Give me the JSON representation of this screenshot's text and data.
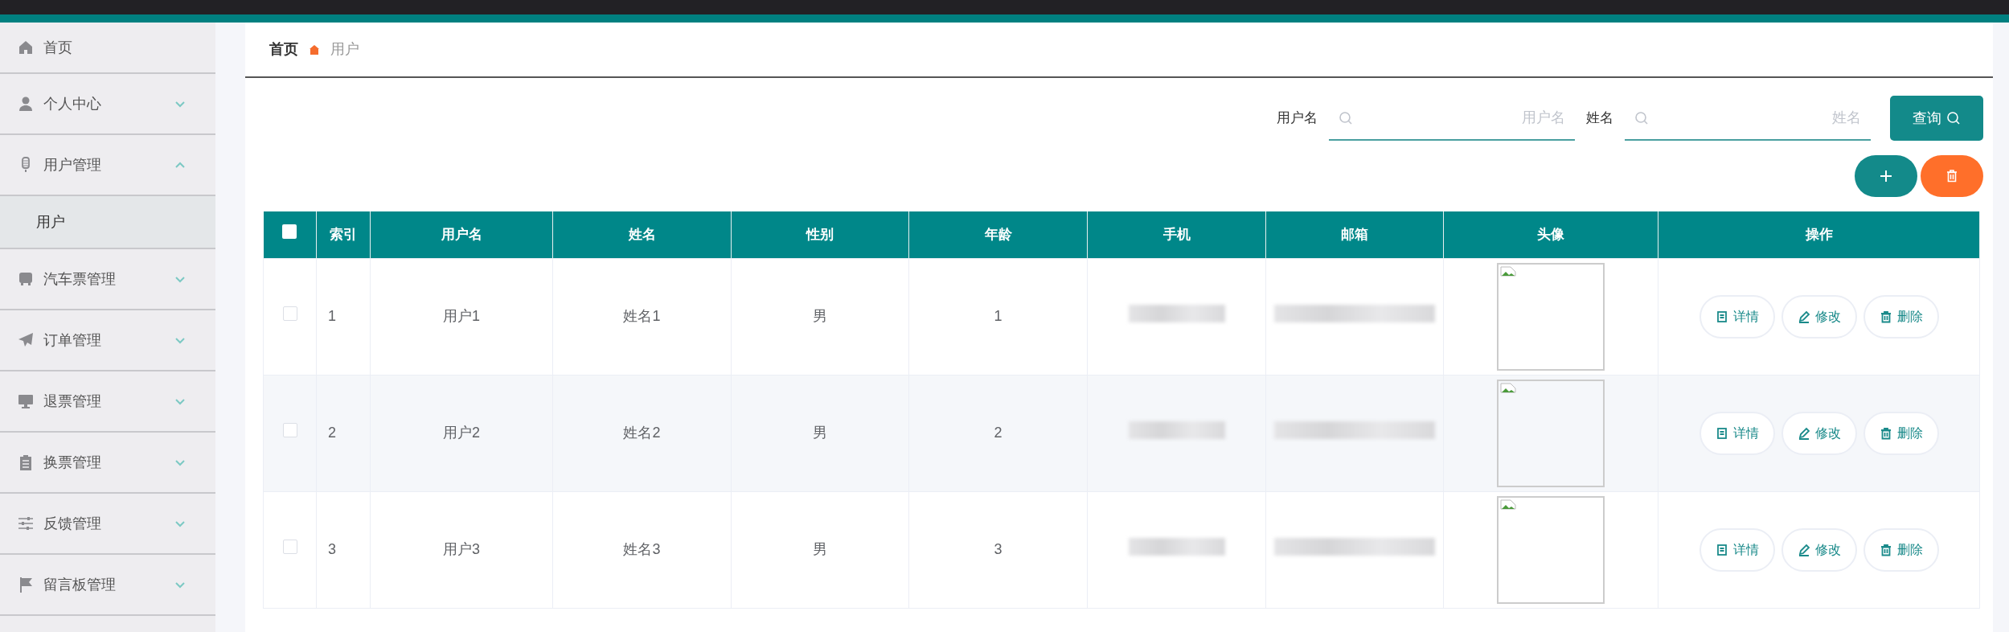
{
  "sidebar": {
    "items": [
      {
        "kind": "link",
        "label": "首页"
      },
      {
        "kind": "menu",
        "label": "个人中心",
        "expanded": false
      },
      {
        "kind": "menu",
        "label": "用户管理",
        "expanded": true,
        "children": [
          {
            "label": "用户",
            "selected": true
          }
        ]
      },
      {
        "kind": "menu",
        "label": "汽车票管理",
        "expanded": false
      },
      {
        "kind": "menu",
        "label": "订单管理",
        "expanded": false
      },
      {
        "kind": "menu",
        "label": "退票管理",
        "expanded": false
      },
      {
        "kind": "menu",
        "label": "换票管理",
        "expanded": false
      },
      {
        "kind": "menu",
        "label": "反馈管理",
        "expanded": false
      },
      {
        "kind": "menu",
        "label": "留言板管理",
        "expanded": false
      }
    ]
  },
  "breadcrumb": [
    "首页",
    "用户"
  ],
  "search": {
    "fields": [
      {
        "label": "用户名",
        "placeholder": "用户名"
      },
      {
        "label": "姓名",
        "placeholder": "姓名"
      }
    ],
    "button": "查询"
  },
  "table": {
    "select_all_checked": false,
    "columns": [
      "索引",
      "用户名",
      "姓名",
      "性别",
      "年龄",
      "手机",
      "邮箱",
      "头像",
      "操作"
    ],
    "rows": [
      {
        "selected": false,
        "index": "1",
        "username": "用户1",
        "name": "姓名1",
        "gender": "男",
        "age": "1",
        "phone_redacted": true,
        "email_redacted": true,
        "actions": [
          "详情",
          "修改",
          "删除"
        ]
      },
      {
        "selected": false,
        "index": "2",
        "username": "用户2",
        "name": "姓名2",
        "gender": "男",
        "age": "2",
        "phone_redacted": true,
        "email_redacted": true,
        "actions": [
          "详情",
          "修改",
          "删除"
        ]
      },
      {
        "selected": false,
        "index": "3",
        "username": "用户3",
        "name": "姓名3",
        "gender": "男",
        "age": "3",
        "phone_redacted": true,
        "email_redacted": true,
        "actions": [
          "详情",
          "修改",
          "删除"
        ]
      }
    ]
  }
}
